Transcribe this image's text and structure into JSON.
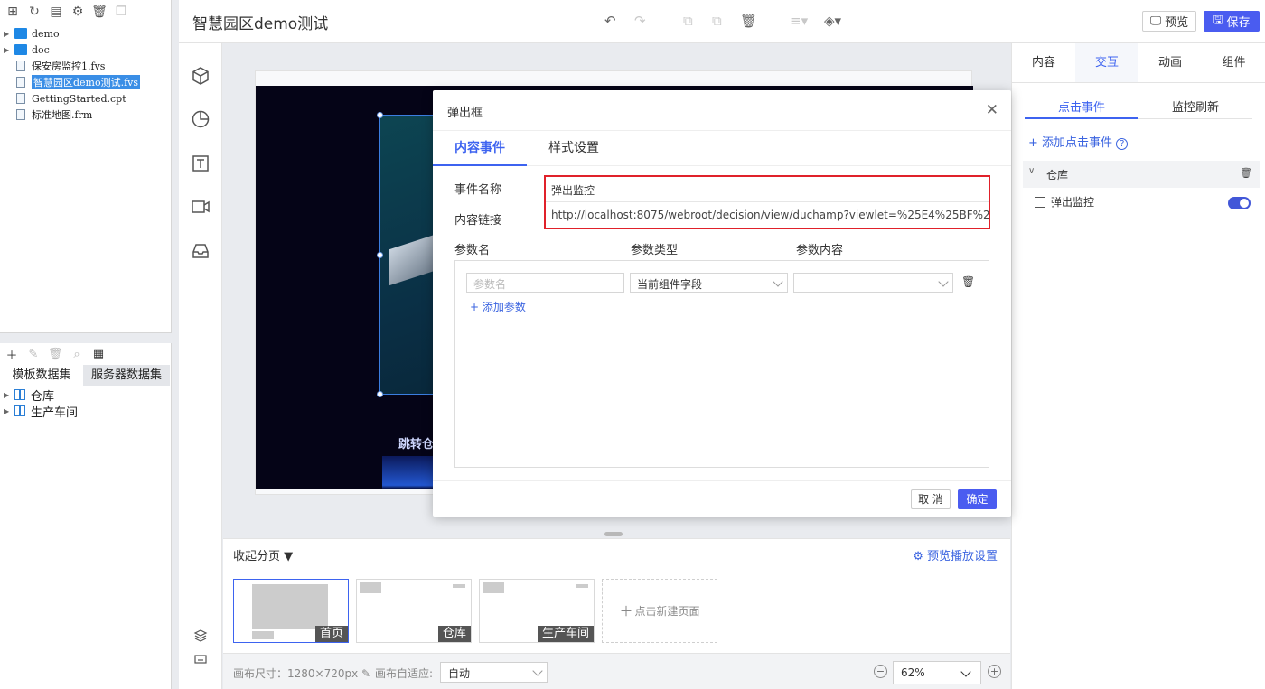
{
  "left_panel": {
    "files": [
      {
        "name": "demo",
        "type": "folder"
      },
      {
        "name": "doc",
        "type": "folder"
      },
      {
        "name": "保安房监控1.fvs",
        "type": "file"
      },
      {
        "name": "智慧园区demo测试.fvs",
        "type": "file",
        "selected": true
      },
      {
        "name": "GettingStarted.cpt",
        "type": "file"
      },
      {
        "name": "标准地图.frm",
        "type": "file"
      }
    ],
    "dataset_tabs": [
      "模板数据集",
      "服务器数据集"
    ],
    "datasets": [
      "仓库",
      "生产车间"
    ]
  },
  "header": {
    "title": "智慧园区demo测试",
    "preview_label": "预览",
    "save_label": "保存"
  },
  "pages_bar": {
    "collapse_label": "收起分页",
    "preview_play_label": "预览播放设置",
    "pages": [
      "首页",
      "仓库",
      "生产车间"
    ],
    "new_page_label": "点击新建页面"
  },
  "status_bar": {
    "canvas_size_label": "画布尺寸：1280×720px",
    "adapt_label": "画布自适应:",
    "adapt_value": "自动",
    "zoom_value": "62%"
  },
  "canvas": {
    "jump_text": "跳转仓"
  },
  "right_panel": {
    "tabs": [
      "内容",
      "交互",
      "动画",
      "组件"
    ],
    "active_tab": "交互",
    "sub_tabs": [
      "点击事件",
      "监控刷新"
    ],
    "add_click_label": "+ 添加点击事件",
    "group_label": "仓库",
    "event_label": "弹出监控",
    "toggle_on": true
  },
  "modal": {
    "title": "弹出框",
    "tabs": [
      "内容事件",
      "样式设置"
    ],
    "event_name_label": "事件名称",
    "event_name_value": "弹出监控",
    "content_link_label": "内容链接",
    "content_link_value": "http://localhost:8075/webroot/decision/view/duchamp?viewlet=%25E4%25BF%259D%25E",
    "param_headers": [
      "参数名",
      "参数类型",
      "参数内容"
    ],
    "param_name_placeholder": "参数名",
    "param_type_value": "当前组件字段",
    "param_content_value": "",
    "add_param_label": "+ 添加参数",
    "cancel_label": "取 消",
    "ok_label": "确定"
  },
  "colors": {
    "accent": "#3d63f0",
    "primary_button": "#4a5cf0",
    "highlight_border": "#e0212a"
  }
}
